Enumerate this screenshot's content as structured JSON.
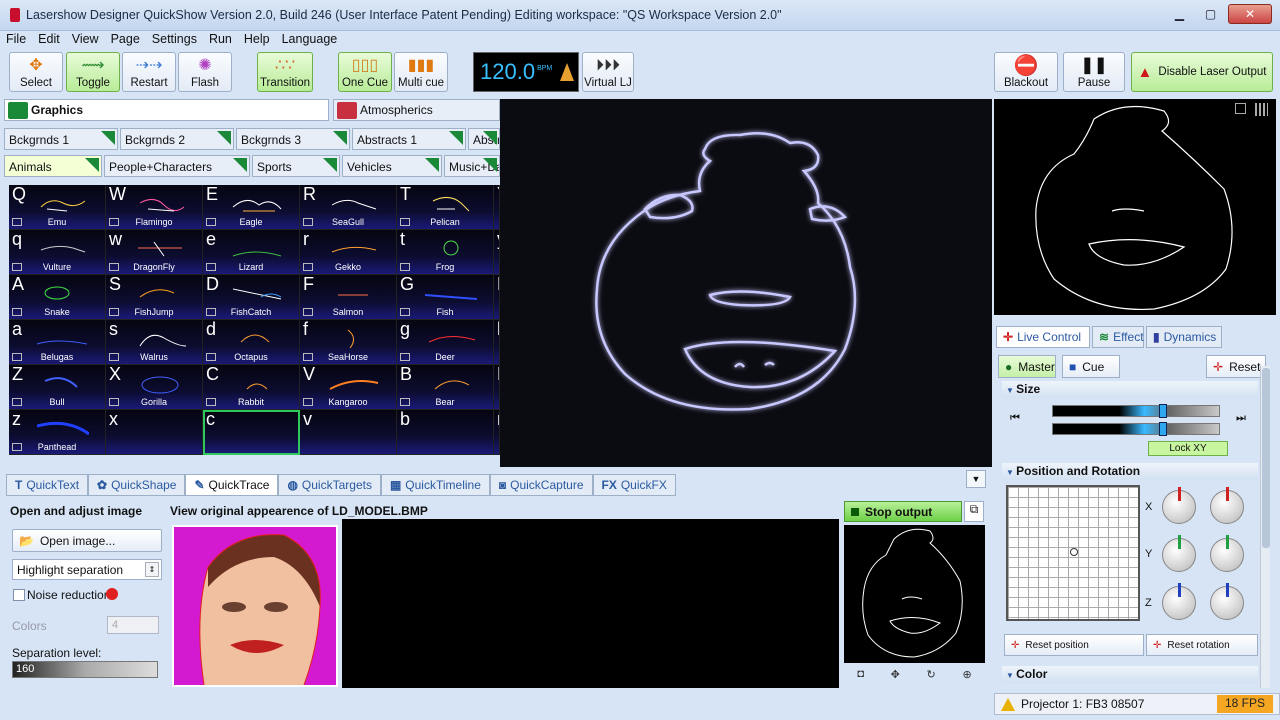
{
  "window": {
    "title": "Lasershow Designer QuickShow   Version 2.0, Build 246   (User Interface Patent Pending)   Editing workspace: \"QS Workspace Version 2.0\""
  },
  "menu": [
    "File",
    "Edit",
    "View",
    "Page",
    "Settings",
    "Run",
    "Help",
    "Language"
  ],
  "toolbar": {
    "select": "Select",
    "toggle": "Toggle",
    "restart": "Restart",
    "flash": "Flash",
    "transition": "Transition",
    "one_cue": "One Cue",
    "multi_cue": "Multi cue",
    "bpm_value": "120.0",
    "bpm_unit": "BPM",
    "virtual_lj": "Virtual LJ",
    "blackout": "Blackout",
    "pause": "Pause",
    "disable_laser": "Disable Laser Output"
  },
  "categories": [
    {
      "label": "Graphics",
      "color": "#1a8a38"
    },
    {
      "label": "Atmospherics",
      "color": "#c83040"
    }
  ],
  "subtabs_row1": [
    "Bckgrnds 1",
    "Bckgrnds 2",
    "Bckgrnds 3",
    "Abstracts 1",
    "Abstra"
  ],
  "subtabs_row2": [
    "Animals",
    "People+Characters",
    "Sports",
    "Vehicles",
    "Music+Dan"
  ],
  "cues": [
    [
      {
        "k": "Q",
        "n": "Emu"
      },
      {
        "k": "W",
        "n": "Flamingo"
      },
      {
        "k": "E",
        "n": "Eagle"
      },
      {
        "k": "R",
        "n": "SeaGull"
      },
      {
        "k": "T",
        "n": "Pelican"
      },
      {
        "k": "Y",
        "n": ""
      }
    ],
    [
      {
        "k": "q",
        "n": "Vulture"
      },
      {
        "k": "w",
        "n": "DragonFly"
      },
      {
        "k": "e",
        "n": "Lizard"
      },
      {
        "k": "r",
        "n": "Gekko"
      },
      {
        "k": "t",
        "n": "Frog"
      },
      {
        "k": "y",
        "n": ""
      }
    ],
    [
      {
        "k": "A",
        "n": "Snake"
      },
      {
        "k": "S",
        "n": "FishJump"
      },
      {
        "k": "D",
        "n": "FishCatch"
      },
      {
        "k": "F",
        "n": "Salmon"
      },
      {
        "k": "G",
        "n": "Fish"
      },
      {
        "k": "H",
        "n": ""
      }
    ],
    [
      {
        "k": "a",
        "n": "Belugas"
      },
      {
        "k": "s",
        "n": "Walrus"
      },
      {
        "k": "d",
        "n": "Octapus"
      },
      {
        "k": "f",
        "n": "SeaHorse"
      },
      {
        "k": "g",
        "n": "Deer"
      },
      {
        "k": "h",
        "n": ""
      }
    ],
    [
      {
        "k": "Z",
        "n": "Bull"
      },
      {
        "k": "X",
        "n": "Gorilla"
      },
      {
        "k": "C",
        "n": "Rabbit"
      },
      {
        "k": "V",
        "n": "Kangaroo"
      },
      {
        "k": "B",
        "n": "Bear"
      },
      {
        "k": "N",
        "n": ""
      }
    ],
    [
      {
        "k": "z",
        "n": "Panthead"
      },
      {
        "k": "x",
        "n": ""
      },
      {
        "k": "c",
        "n": ""
      },
      {
        "k": "v",
        "n": ""
      },
      {
        "k": "b",
        "n": ""
      },
      {
        "k": "n",
        "n": ""
      }
    ]
  ],
  "quicktabs": [
    {
      "icon": "T",
      "label": "QuickText"
    },
    {
      "icon": "✿",
      "label": "QuickShape"
    },
    {
      "icon": "✎",
      "label": "QuickTrace"
    },
    {
      "icon": "◍",
      "label": "QuickTargets"
    },
    {
      "icon": "▦",
      "label": "QuickTimeline"
    },
    {
      "icon": "◙",
      "label": "QuickCapture"
    },
    {
      "icon": "FX",
      "label": "QuickFX"
    }
  ],
  "quicktrace": {
    "left_title": "Open and adjust image",
    "open_image": "Open image...",
    "mode": "Highlight separation",
    "noise_reduction": "Noise reduction",
    "colors_label": "Colors",
    "colors_value": "4",
    "separation_label": "Separation level:",
    "separation_value": "160",
    "view_title": "View original appearence of LD_MODEL.BMP",
    "stop_output": "Stop output"
  },
  "rightpanel": {
    "tabs": [
      "Live Control",
      "Effect",
      "Dynamics"
    ],
    "master": "Master",
    "cue": "Cue",
    "reset": "Reset",
    "size_title": "Size",
    "lock_xy": "Lock XY",
    "position_title": "Position and Rotation",
    "axis_x": "X",
    "axis_y": "Y",
    "axis_z": "Z",
    "reset_position": "Reset position",
    "reset_rotation": "Reset rotation",
    "color_title": "Color"
  },
  "status": {
    "projector": "Projector 1: FB3 08507",
    "fps": "18 FPS"
  }
}
